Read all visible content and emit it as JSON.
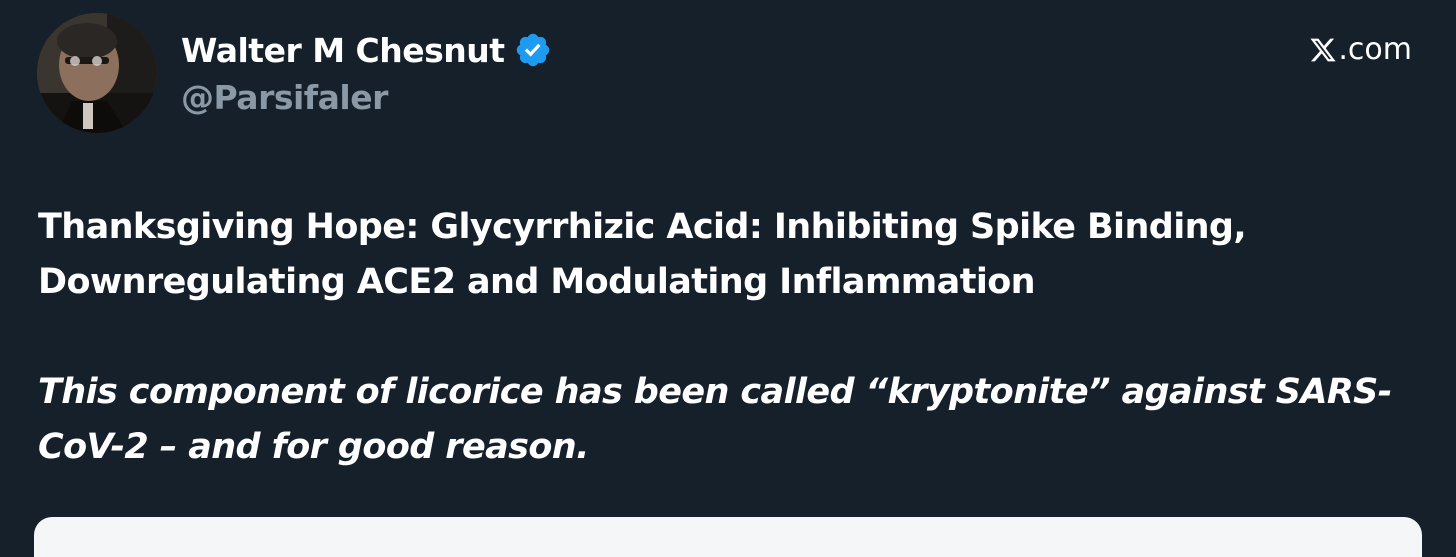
{
  "author": {
    "display_name": "Walter M Chesnut",
    "handle": "@Parsifaler",
    "verified": true,
    "avatar_icon": "profile-photo"
  },
  "brand": {
    "label": ".com",
    "icon": "x-logo-icon"
  },
  "post": {
    "headline": "Thanksgiving Hope: Glycyrrhizic Acid: Inhibiting Spike Binding, Downregulating ACE2 and Modulating Inflammation",
    "subtitle": "This component of licorice has been called “kryptonite” against SARS-CoV-2 – and for good reason."
  },
  "colors": {
    "background": "#15202b",
    "text": "#ffffff",
    "handle": "#8b98a5",
    "verified_badge": "#1d9bf0"
  }
}
